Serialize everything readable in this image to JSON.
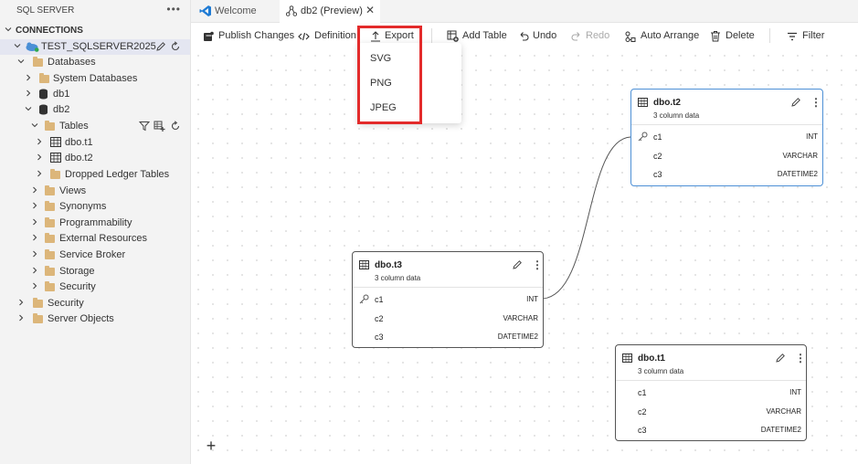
{
  "sidebar": {
    "title": "SQL SERVER",
    "section": "CONNECTIONS",
    "server": "TEST_SQLSERVER2025",
    "items": {
      "databases": "Databases",
      "system_databases": "System Databases",
      "db1": "db1",
      "db2": "db2",
      "tables": "Tables",
      "t1": "dbo.t1",
      "t2": "dbo.t2",
      "dropped_ledger": "Dropped Ledger Tables",
      "views": "Views",
      "synonyms": "Synonyms",
      "programmability": "Programmability",
      "external_resources": "External Resources",
      "service_broker": "Service Broker",
      "storage": "Storage",
      "security_db": "Security",
      "security": "Security",
      "server_objects": "Server Objects"
    }
  },
  "tabs": {
    "welcome": "Welcome",
    "db2": "db2 (Preview)"
  },
  "toolbar": {
    "publish": "Publish Changes",
    "definition": "Definition",
    "export": "Export",
    "add_table": "Add Table",
    "undo": "Undo",
    "redo": "Redo",
    "auto_arrange": "Auto Arrange",
    "delete": "Delete",
    "filter": "Filter"
  },
  "export_menu": {
    "svg": "SVG",
    "png": "PNG",
    "jpeg": "JPEG"
  },
  "tables": {
    "t2": {
      "name": "dbo.t2",
      "subtitle": "3 column data",
      "columns": [
        {
          "name": "c1",
          "type": "INT"
        },
        {
          "name": "c2",
          "type": "VARCHAR"
        },
        {
          "name": "c3",
          "type": "DATETIME2"
        }
      ]
    },
    "t3": {
      "name": "dbo.t3",
      "subtitle": "3 column data",
      "columns": [
        {
          "name": "c1",
          "type": "INT"
        },
        {
          "name": "c2",
          "type": "VARCHAR"
        },
        {
          "name": "c3",
          "type": "DATETIME2"
        }
      ]
    },
    "t1": {
      "name": "dbo.t1",
      "subtitle": "3 column data",
      "columns": [
        {
          "name": "c1",
          "type": "INT"
        },
        {
          "name": "c2",
          "type": "VARCHAR"
        },
        {
          "name": "c3",
          "type": "DATETIME2"
        }
      ]
    }
  },
  "canvas": {
    "zoom_in": "+"
  },
  "colors": {
    "accent": "#4d90d6",
    "highlight": "#e32b2b",
    "folder": "#dcb67a",
    "vscode_blue": "#1f7bd4"
  }
}
